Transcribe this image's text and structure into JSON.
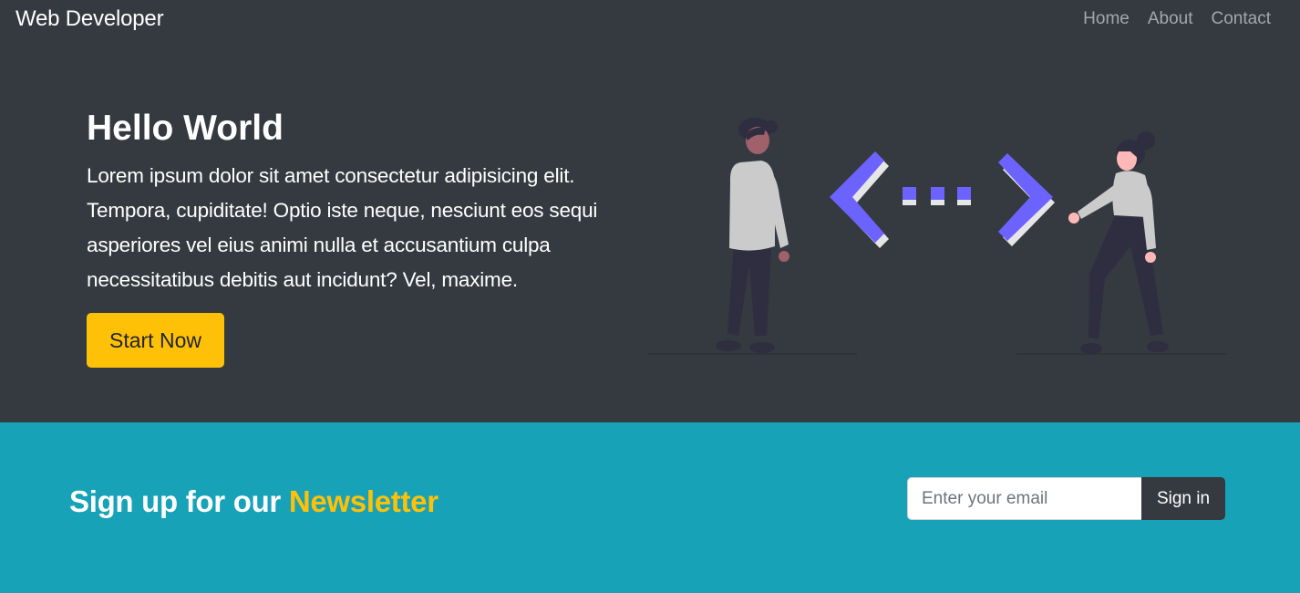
{
  "navbar": {
    "brand": "Web Developer",
    "links": [
      "Home",
      "About",
      "Contact"
    ]
  },
  "hero": {
    "title": "Hello World",
    "body": "Lorem ipsum dolor sit amet consectetur adipisicing elit. Tempora, cupiditate! Optio iste neque, nesciunt eos sequi asperiores vel eius animi nulla et accusantium culpa necessitatibus debitis aut incidunt? Vel, maxime.",
    "button_label": "Start Now"
  },
  "newsletter": {
    "title_prefix": "Sign up for our",
    "title_accent": "Newsletter",
    "email_placeholder": "Enter your email",
    "email_value": "",
    "submit_label": "Sign in"
  },
  "colors": {
    "dark_background": "#343a40",
    "newsletter_background": "#17a2b8",
    "accent_yellow": "#ffc107",
    "illustration_purple": "#6c63ff"
  }
}
